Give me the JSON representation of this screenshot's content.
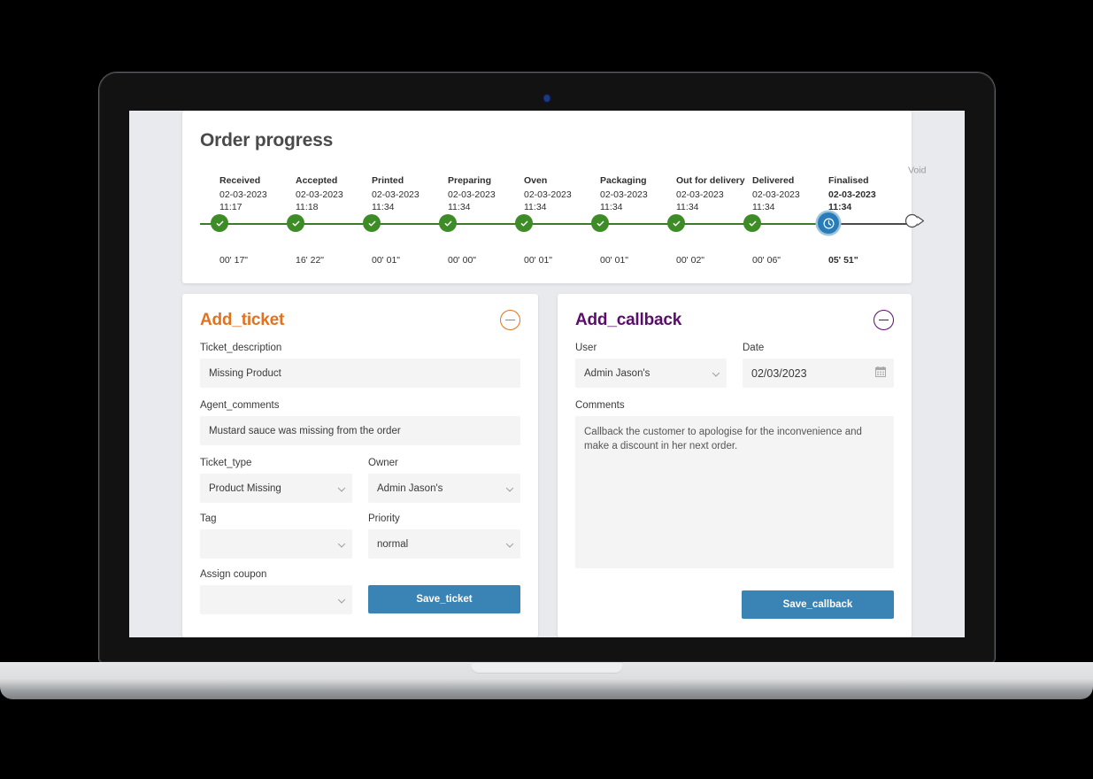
{
  "device": {
    "type": "laptop",
    "camera_icon": "camera-dot"
  },
  "progress": {
    "title": "Order progress",
    "steps": [
      {
        "label": "Received",
        "date": "02-03-2023",
        "time": "11:17",
        "duration": "00' 17\"",
        "state": "done"
      },
      {
        "label": "Accepted",
        "date": "02-03-2023",
        "time": "11:18",
        "duration": "16' 22\"",
        "state": "done"
      },
      {
        "label": "Printed",
        "date": "02-03-2023",
        "time": "11:34",
        "duration": "00' 01\"",
        "state": "done"
      },
      {
        "label": "Preparing",
        "date": "02-03-2023",
        "time": "11:34",
        "duration": "00' 00\"",
        "state": "done"
      },
      {
        "label": "Oven",
        "date": "02-03-2023",
        "time": "11:34",
        "duration": "00' 01\"",
        "state": "done"
      },
      {
        "label": "Packaging",
        "date": "02-03-2023",
        "time": "11:34",
        "duration": "00' 01\"",
        "state": "done"
      },
      {
        "label": "Out for delivery",
        "date": "02-03-2023",
        "time": "11:34",
        "duration": "00' 02\"",
        "state": "done"
      },
      {
        "label": "Delivered",
        "date": "02-03-2023",
        "time": "11:34",
        "duration": "00' 06\"",
        "state": "done"
      },
      {
        "label": "Finalised",
        "date": "02-03-2023",
        "time": "11:34",
        "duration": "05' 51\"",
        "state": "current"
      }
    ],
    "void_label": "Void",
    "colors": {
      "done": "#3e8c27",
      "current": "#2a7cb8",
      "todo": "#4a4a4a",
      "void_text": "#9a9a9a"
    }
  },
  "ticket_panel": {
    "title": "Add_ticket",
    "title_color": "#e2721e",
    "collapse_icon": "minus-circle-icon",
    "description_label": "Ticket_description",
    "description_value": "Missing Product",
    "agent_comments_label": "Agent_comments",
    "agent_comments_value": "Mustard sauce was missing from the order",
    "ticket_type_label": "Ticket_type",
    "ticket_type_value": "Product Missing",
    "owner_label": "Owner",
    "owner_value": "Admin Jason's",
    "tag_label": "Tag",
    "tag_value": "",
    "priority_label": "Priority",
    "priority_value": "normal",
    "assign_coupon_label": "Assign coupon",
    "assign_coupon_value": "",
    "save_label": "Save_ticket",
    "save_color": "#3a84b5"
  },
  "callback_panel": {
    "title": "Add_callback",
    "title_color": "#5b0d6b",
    "collapse_icon": "minus-circle-icon",
    "user_label": "User",
    "user_value": "Admin Jason's",
    "date_label": "Date",
    "date_value": "02/03/2023",
    "date_icon": "calendar-icon",
    "comments_label": "Comments",
    "comments_value": "Callback the customer to apologise for the inconvenience and make a discount in her next order.",
    "save_label": "Save_callback",
    "save_color": "#3a84b5"
  }
}
